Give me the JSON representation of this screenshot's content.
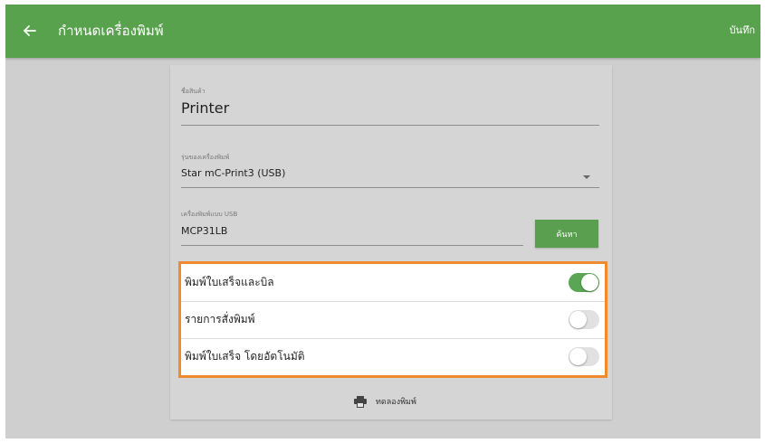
{
  "header": {
    "back_icon": "arrow-left-icon",
    "title": "กำหนดเครื่องพิมพ์",
    "save_label": "บันทึก",
    "color": "#58a14d"
  },
  "form": {
    "product_name": {
      "label": "ชื่อสินค้า",
      "value": "Printer"
    },
    "printer_model": {
      "label": "รุ่นของเครื่องพิมพ์",
      "value": "Star mC-Print3 (USB)",
      "icon": "dropdown-arrow-icon"
    },
    "usb_printer": {
      "label": "เครื่องพิมพ์แบบ USB",
      "value": "MCP31LB",
      "search_label": "ค้นหา"
    }
  },
  "settings": {
    "highlight_color": "#ef8a2e",
    "items": [
      {
        "label": "พิมพ์ใบเสร็จและบิล",
        "enabled": true
      },
      {
        "label": "รายการสั่งพิมพ์",
        "enabled": false
      },
      {
        "label": "พิมพ์ใบเสร็จ โดยอัตโนมัติ",
        "enabled": false
      }
    ]
  },
  "actions": {
    "test_print_label": "ทดลองพิมพ์",
    "test_print_icon": "printer-icon"
  }
}
